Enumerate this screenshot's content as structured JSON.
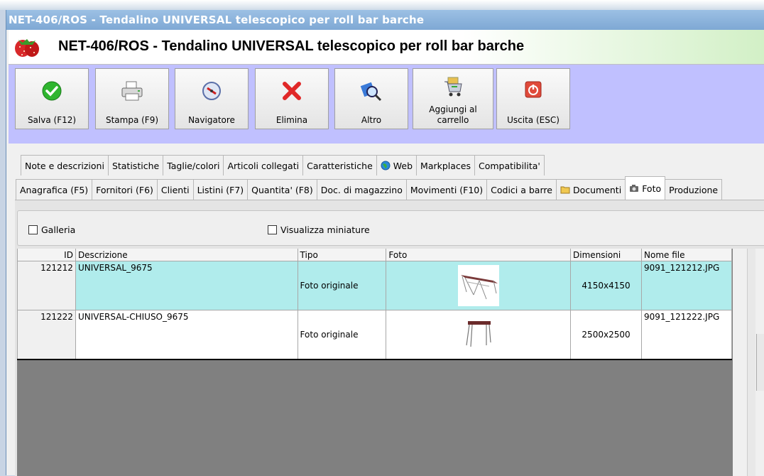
{
  "window": {
    "title": "NET-406/ROS - Tendalino UNIVERSAL telescopico per roll bar barche",
    "banner_title": "NET-406/ROS - Tendalino UNIVERSAL telescopico per roll bar barche"
  },
  "toolbar": {
    "save_label": "Salva (F12)",
    "print_label": "Stampa (F9)",
    "navigator_label": "Navigatore",
    "delete_label": "Elimina",
    "more_label": "Altro",
    "cart_label": "Aggiungi al carrello",
    "exit_label": "Uscita (ESC)"
  },
  "tabs_row1": [
    "Note e descrizioni",
    "Statistiche",
    "Taglie/colori",
    "Articoli collegati",
    "Caratteristiche",
    "Web",
    "Markplaces",
    "Compatibilita'"
  ],
  "tabs_row2": [
    "Anagrafica (F5)",
    "Fornitori (F6)",
    "Clienti",
    "Listini (F7)",
    "Quantita' (F8)",
    "Doc. di magazzino",
    "Movimenti (F10)",
    "Codici a barre",
    "Documenti",
    "Foto",
    "Produzione"
  ],
  "active_tab": "Foto",
  "filters": {
    "gallery_label": "Galleria",
    "gallery_checked": false,
    "thumbs_label": "Visualizza miniature",
    "thumbs_checked": false
  },
  "grid": {
    "columns": [
      "ID",
      "Descrizione",
      "Tipo",
      "Foto",
      "Dimensioni",
      "Nome file"
    ],
    "rows": [
      {
        "id": "121212",
        "descrizione": "UNIVERSAL_9675",
        "tipo": "Foto originale",
        "dimensioni": "4150x4150",
        "nome_file": "9091_121212.JPG",
        "selected": true
      },
      {
        "id": "121222",
        "descrizione": "UNIVERSAL-CHIUSO_9675",
        "tipo": "Foto originale",
        "dimensioni": "2500x2500",
        "nome_file": "9091_121222.JPG",
        "selected": false
      }
    ]
  },
  "colors": {
    "toolbar_bg": "#c0c0ff",
    "selected_row": "#b0ecec",
    "title_bar": "#7ea8d4"
  }
}
